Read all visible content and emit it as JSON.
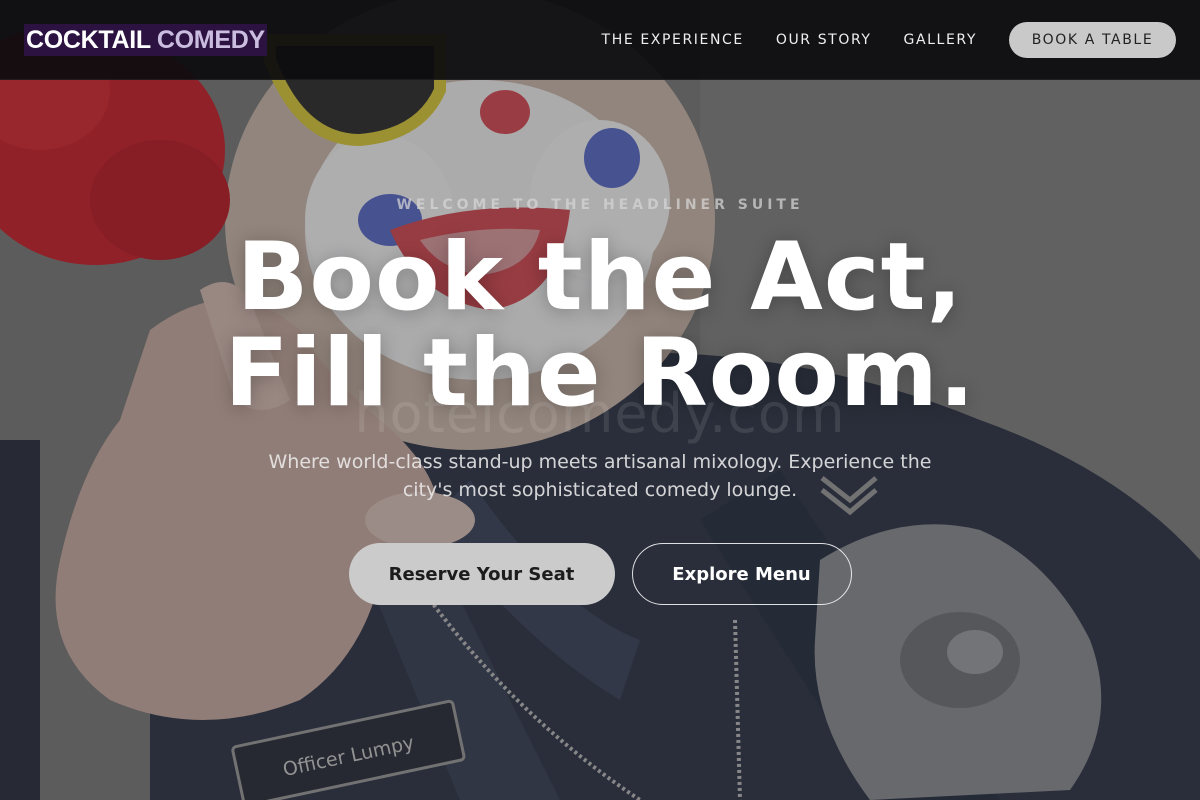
{
  "nav": {
    "brand_word_1": "COCKTAIL",
    "brand_word_2": "COMEDY",
    "links": [
      {
        "label": "THE EXPERIENCE"
      },
      {
        "label": "OUR STORY"
      },
      {
        "label": "GALLERY"
      }
    ],
    "cta_label": "BOOK A TABLE"
  },
  "hero": {
    "eyebrow": "WELCOME TO THE HEADLINER SUITE",
    "headline_line_1": "Book the Act,",
    "headline_line_2": "Fill the Room.",
    "tagline": "Where world-class stand-up meets artisanal mixology. Experience the city's most sophisticated comedy lounge.",
    "primary_button": "Reserve Your Seat",
    "secondary_button": "Explore Menu",
    "background_name_tag": "Officer Lumpy",
    "watermark": "hotelcomedy.com"
  },
  "colors": {
    "nav_background": "#0c0c0e",
    "brand_accent": "#2c1240",
    "brand_word_2": "#cbbde0",
    "cta_background": "#c9c9c9",
    "primary_button_background": "#cbcbcb"
  }
}
